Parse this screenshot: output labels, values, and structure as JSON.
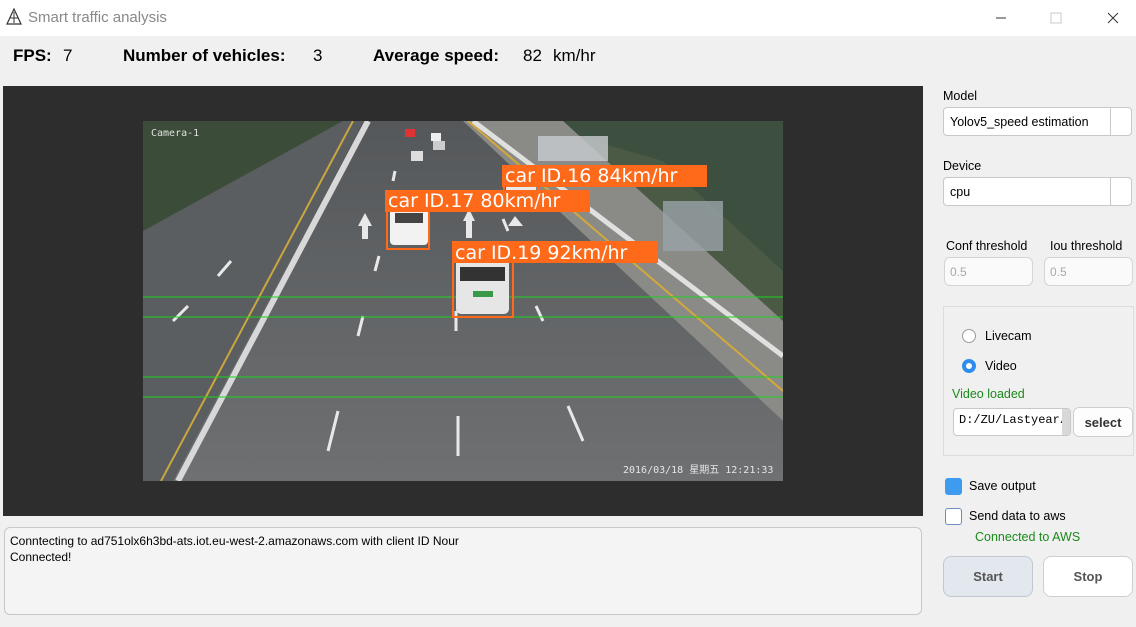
{
  "window": {
    "title": "Smart traffic analysis",
    "icon": "traffic-cone-icon"
  },
  "stats": {
    "fps_label": "FPS:",
    "fps_value": "7",
    "vehicles_label": "Number of vehicles:",
    "vehicles_value": "3",
    "speed_label": "Average speed:",
    "speed_value": "82",
    "speed_unit": "km/hr"
  },
  "video": {
    "camera_label": "Camera-1",
    "timestamp": "2016/03/18 星期五 12:21:33",
    "detections": [
      {
        "label": "car ID.16 84km/hr"
      },
      {
        "label": "car ID.17 80km/hr"
      },
      {
        "label": "car ID.19 92km/hr"
      }
    ],
    "box_color": "#ff6a1a",
    "line_color": "#1ed21e"
  },
  "log": {
    "lines": [
      "Conntecting to ad751olx6h3bd-ats.iot.eu-west-2.amazonaws.com with client ID Nour",
      "Connected!"
    ]
  },
  "sidebar": {
    "model_label": "Model",
    "model_value": "Yolov5_speed estimation",
    "device_label": "Device",
    "device_value": "cpu",
    "conf_label": "Conf threshold",
    "conf_value": "0.5",
    "iou_label": "Iou threshold",
    "iou_value": "0.5",
    "source": {
      "livecam_label": "Livecam",
      "video_label": "Video",
      "selected": "Video",
      "status": "Video loaded",
      "status_color": "#1a8a1a",
      "path": "D:/ZU/Lastyear/",
      "select_label": "select"
    },
    "save_output_label": "Save output",
    "save_output_checked": true,
    "send_aws_label": "Send data to aws",
    "send_aws_checked": false,
    "aws_status": "Connected to AWS",
    "start_label": "Start",
    "stop_label": "Stop"
  }
}
